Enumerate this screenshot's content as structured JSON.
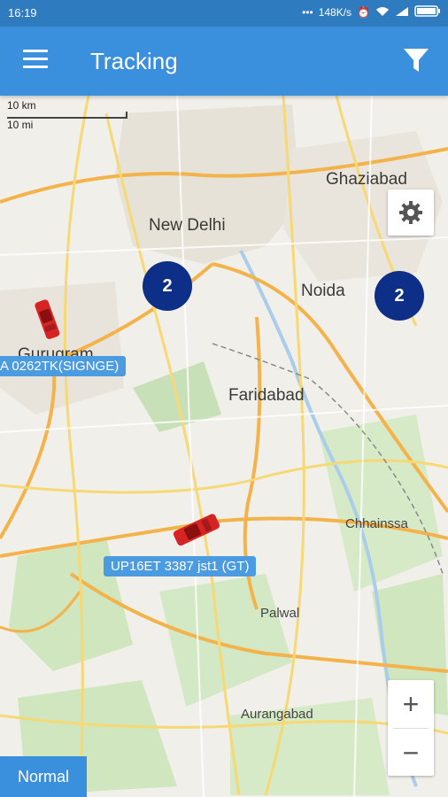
{
  "status_bar": {
    "time": "16:19",
    "network_speed": "148K/s"
  },
  "app_bar": {
    "title": "Tracking"
  },
  "map": {
    "scale_km": "10 km",
    "scale_mi": "10 mi",
    "places": {
      "ghaziabad": "Ghaziabad",
      "new_delhi": "New Delhi",
      "noida": "Noida",
      "gurugram": "Gurugram",
      "faridabad": "Faridabad",
      "chhainssa": "Chhainssa",
      "palwal": "Palwal",
      "aurangabad": "Aurangabad"
    },
    "clusters": [
      {
        "count": "2"
      },
      {
        "count": "2"
      }
    ],
    "vehicles": [
      {
        "label": "A 0262TK(SIGNGE)"
      },
      {
        "label": "UP16ET 3387 jst1 (GT)"
      }
    ]
  },
  "controls": {
    "zoom_in": "+",
    "zoom_out": "−",
    "map_type": "Normal"
  }
}
